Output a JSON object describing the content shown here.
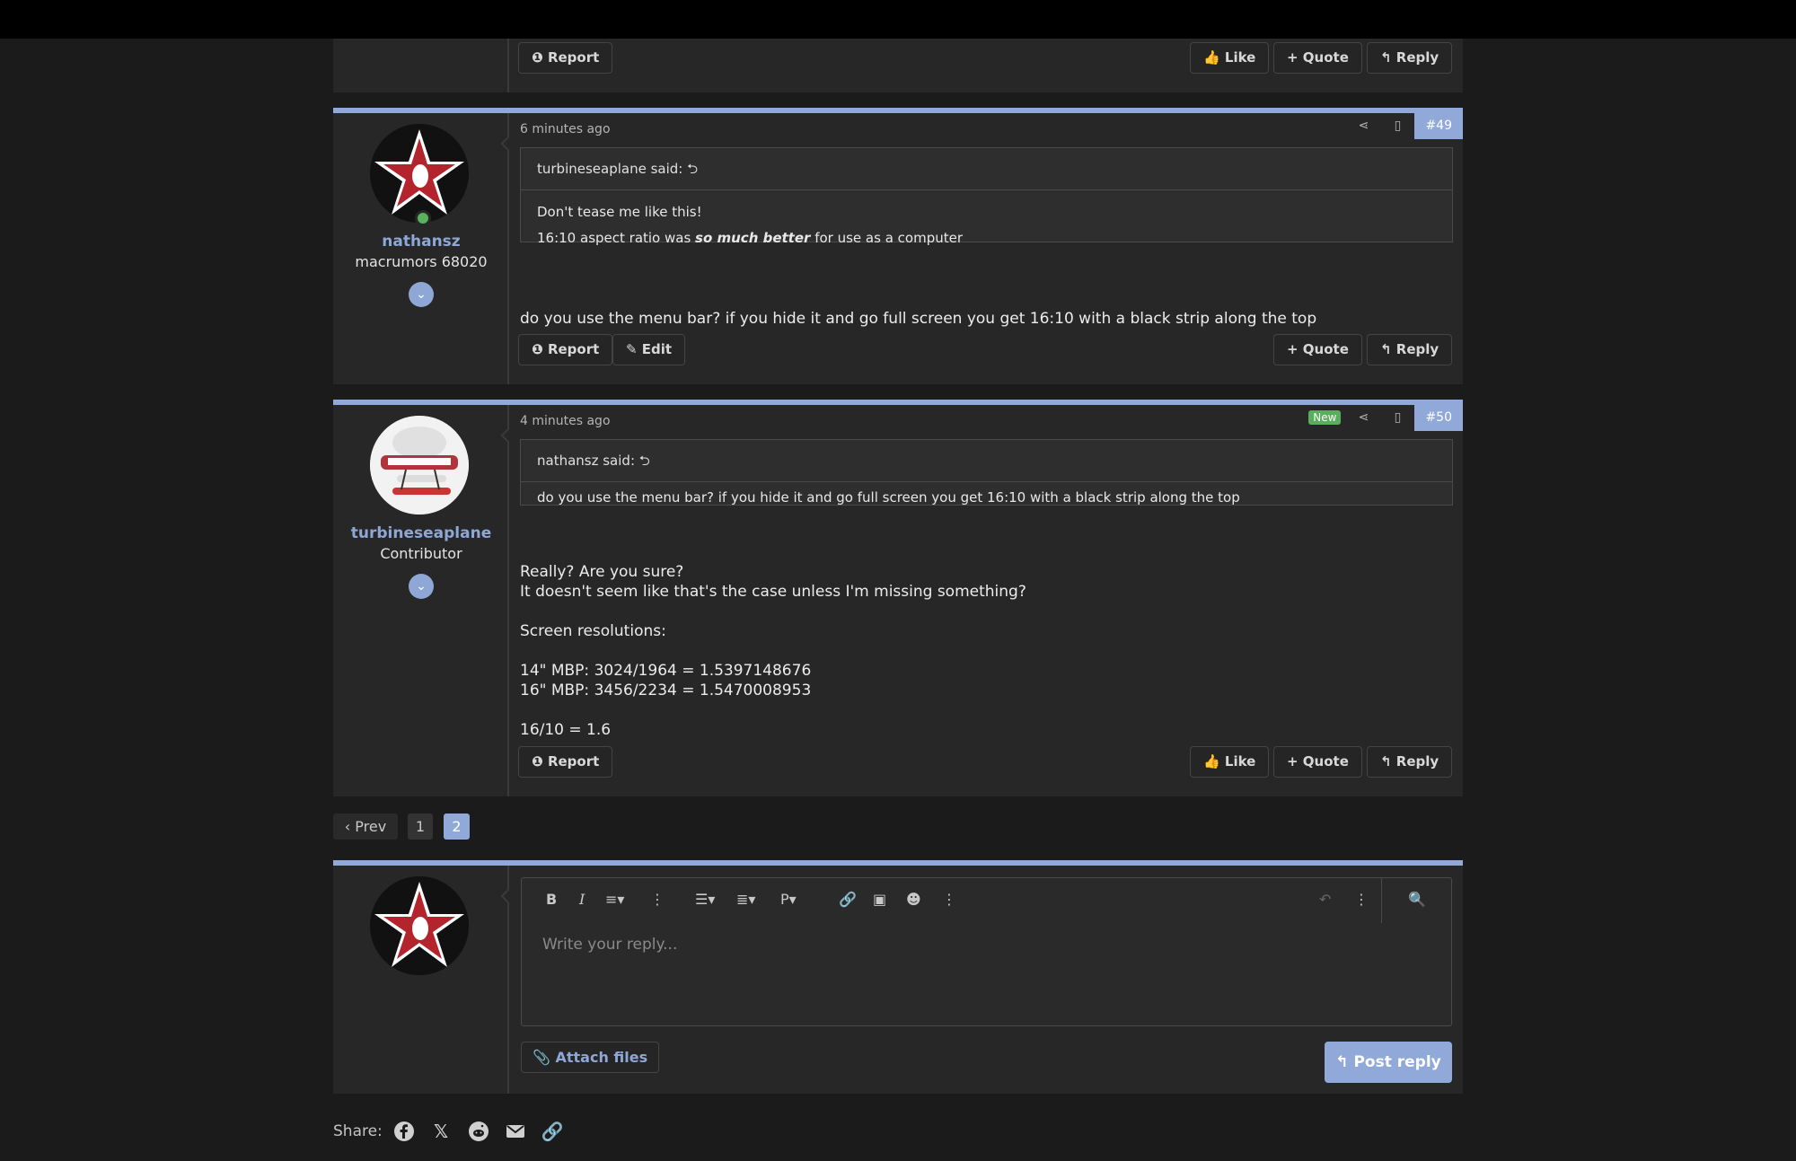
{
  "prev_post": {
    "report": "Report",
    "like": "Like",
    "quote": "Quote",
    "reply": "Reply"
  },
  "post49": {
    "username": "nathansz",
    "user_title": "macrumors 68020",
    "time": "6 minutes ago",
    "number": "#49",
    "quote_author": "turbineseaplane said:",
    "quote_line1": "Don't tease me like this!",
    "quote_line2_pre": "16:10 aspect ratio was ",
    "quote_line2_bold": "so much better",
    "quote_line2_post": " for use as a computer",
    "body": "do you use the menu bar? if you hide it and go full screen you get 16:10 with a black strip along the top",
    "report": "Report",
    "edit": "Edit",
    "quote": "Quote",
    "reply": "Reply"
  },
  "post50": {
    "username": "turbineseaplane",
    "user_title": "Contributor",
    "time": "4 minutes ago",
    "new_badge": "New",
    "number": "#50",
    "quote_author": "nathansz said:",
    "quote_text": "do you use the menu bar? if you hide it and go full screen you get 16:10 with a black strip along the top",
    "lines": [
      "Really? Are you sure?",
      "It doesn't seem like that's the case unless I'm missing something?",
      "",
      "Screen resolutions:",
      "",
      "14\" MBP: 3024/1964 = 1.5397148676",
      "16\" MBP: 3456/2234 = 1.5470008953",
      "",
      "16/10 = 1.6"
    ],
    "report": "Report",
    "like": "Like",
    "quote": "Quote",
    "reply": "Reply"
  },
  "pagination": {
    "prev": "‹ Prev",
    "pages": [
      "1",
      "2"
    ],
    "current": "2"
  },
  "reply_box": {
    "placeholder": "Write your reply...",
    "attach": "Attach files",
    "post": "Post reply",
    "toolbar": [
      "bold-icon",
      "italic-icon",
      "text-align-icon",
      "more-icon",
      "list-icon",
      "align-icon",
      "paragraph-icon",
      "link-icon",
      "image-icon",
      "emoji-icon",
      "more-icon",
      "undo-icon",
      "more-icon",
      "preview-icon"
    ],
    "paragraph_label": "P"
  },
  "share": {
    "label": "Share:",
    "icons": [
      "facebook-icon",
      "x-icon",
      "reddit-icon",
      "email-icon",
      "link-icon"
    ]
  },
  "colors": {
    "accent": "#90a9d9",
    "background": "#1b1b1b",
    "panel": "#272727",
    "online": "#58b25a",
    "new_badge": "#5aad5c"
  }
}
